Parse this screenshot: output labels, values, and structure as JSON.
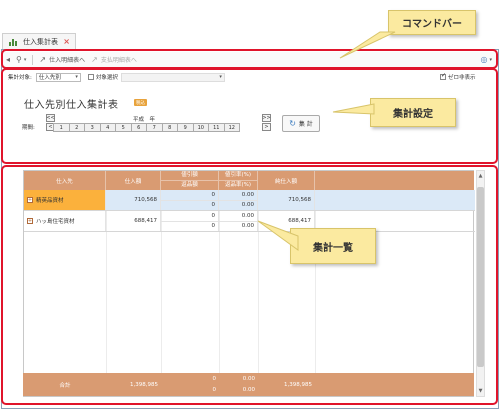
{
  "tab": {
    "label": "仕入集計表",
    "close": "×"
  },
  "commandbar": {
    "search_icon": "magnifier-icon",
    "purchase_detail_link": "仕入明細表へ",
    "payment_detail_link": "支払明細表へ",
    "arrow_glyph": "↗"
  },
  "settings": {
    "aggregate_target_label": "集計対象:",
    "aggregate_target_value": "仕入先別",
    "target_select_label": "対象選択",
    "show_zero_label": "ゼロ非表示",
    "heading": "仕入先別仕入集計表",
    "badge": "税込",
    "period_label": "期間:",
    "year_label": "平成　年",
    "prev_label": "<<",
    "next_label": ">>",
    "prev_single": "<",
    "next_single": ">",
    "months": [
      "1",
      "2",
      "3",
      "4",
      "5",
      "6",
      "7",
      "8",
      "9",
      "10",
      "11",
      "12"
    ],
    "calc_button": "集 計"
  },
  "grid": {
    "headers": {
      "supplier": "仕入先",
      "purchase": "仕入額",
      "discount_top": "値引額",
      "discount_bottom": "返品額",
      "rate_top": "値引率(%)",
      "rate_bottom": "返品率(%)",
      "net": "純仕入額"
    },
    "rows": [
      {
        "supplier": "精英品資材",
        "purchase": "710,568",
        "discount": "0",
        "returns": "0",
        "discount_rate": "0.00",
        "return_rate": "0.00",
        "net": "710,568"
      },
      {
        "supplier": "ハッ島住宅資材",
        "purchase": "688,417",
        "discount": "0",
        "returns": "0",
        "discount_rate": "0.00",
        "return_rate": "0.00",
        "net": "688,417"
      }
    ],
    "footer": {
      "label": "合計",
      "purchase": "1,398,985",
      "discount": "0",
      "returns": "0",
      "discount_rate": "0.00",
      "return_rate": "0.00",
      "net": "1,398,985"
    }
  },
  "callouts": {
    "commandbar": "コマンドバー",
    "settings": "集計設定",
    "list": "集計一覧"
  },
  "colors": {
    "header": "#d99b72",
    "highlight": "#e0142b",
    "callout": "#fbeaa0",
    "selected": "#fbb13c"
  }
}
